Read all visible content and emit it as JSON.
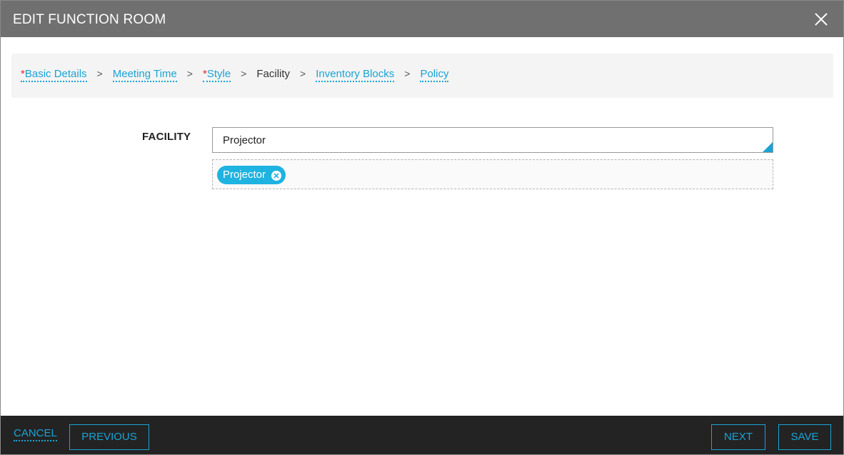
{
  "dialog": {
    "title": "EDIT FUNCTION ROOM",
    "close_icon": "close-icon"
  },
  "breadcrumb": {
    "separator": ">",
    "required_marker": "*",
    "steps": [
      {
        "label": "Basic Details",
        "required": true,
        "state": "link"
      },
      {
        "label": "Meeting Time",
        "required": false,
        "state": "link"
      },
      {
        "label": "Style",
        "required": true,
        "state": "link"
      },
      {
        "label": "Facility",
        "required": false,
        "state": "current"
      },
      {
        "label": "Inventory Blocks",
        "required": false,
        "state": "link"
      },
      {
        "label": "Policy",
        "required": false,
        "state": "link"
      }
    ]
  },
  "form": {
    "facility_label": "FACILITY",
    "facility_input_value": "Projector",
    "selected_tags": [
      {
        "label": "Projector",
        "remove_icon": "remove-circle-x-icon"
      }
    ]
  },
  "footer": {
    "cancel_label": "CANCEL",
    "previous_label": "PREVIOUS",
    "next_label": "NEXT",
    "save_label": "SAVE"
  },
  "colors": {
    "accent": "#1aa3d4",
    "tag_background": "#1eb3e0",
    "required": "#e0262b",
    "titlebar": "#707070",
    "footer": "#232323"
  }
}
